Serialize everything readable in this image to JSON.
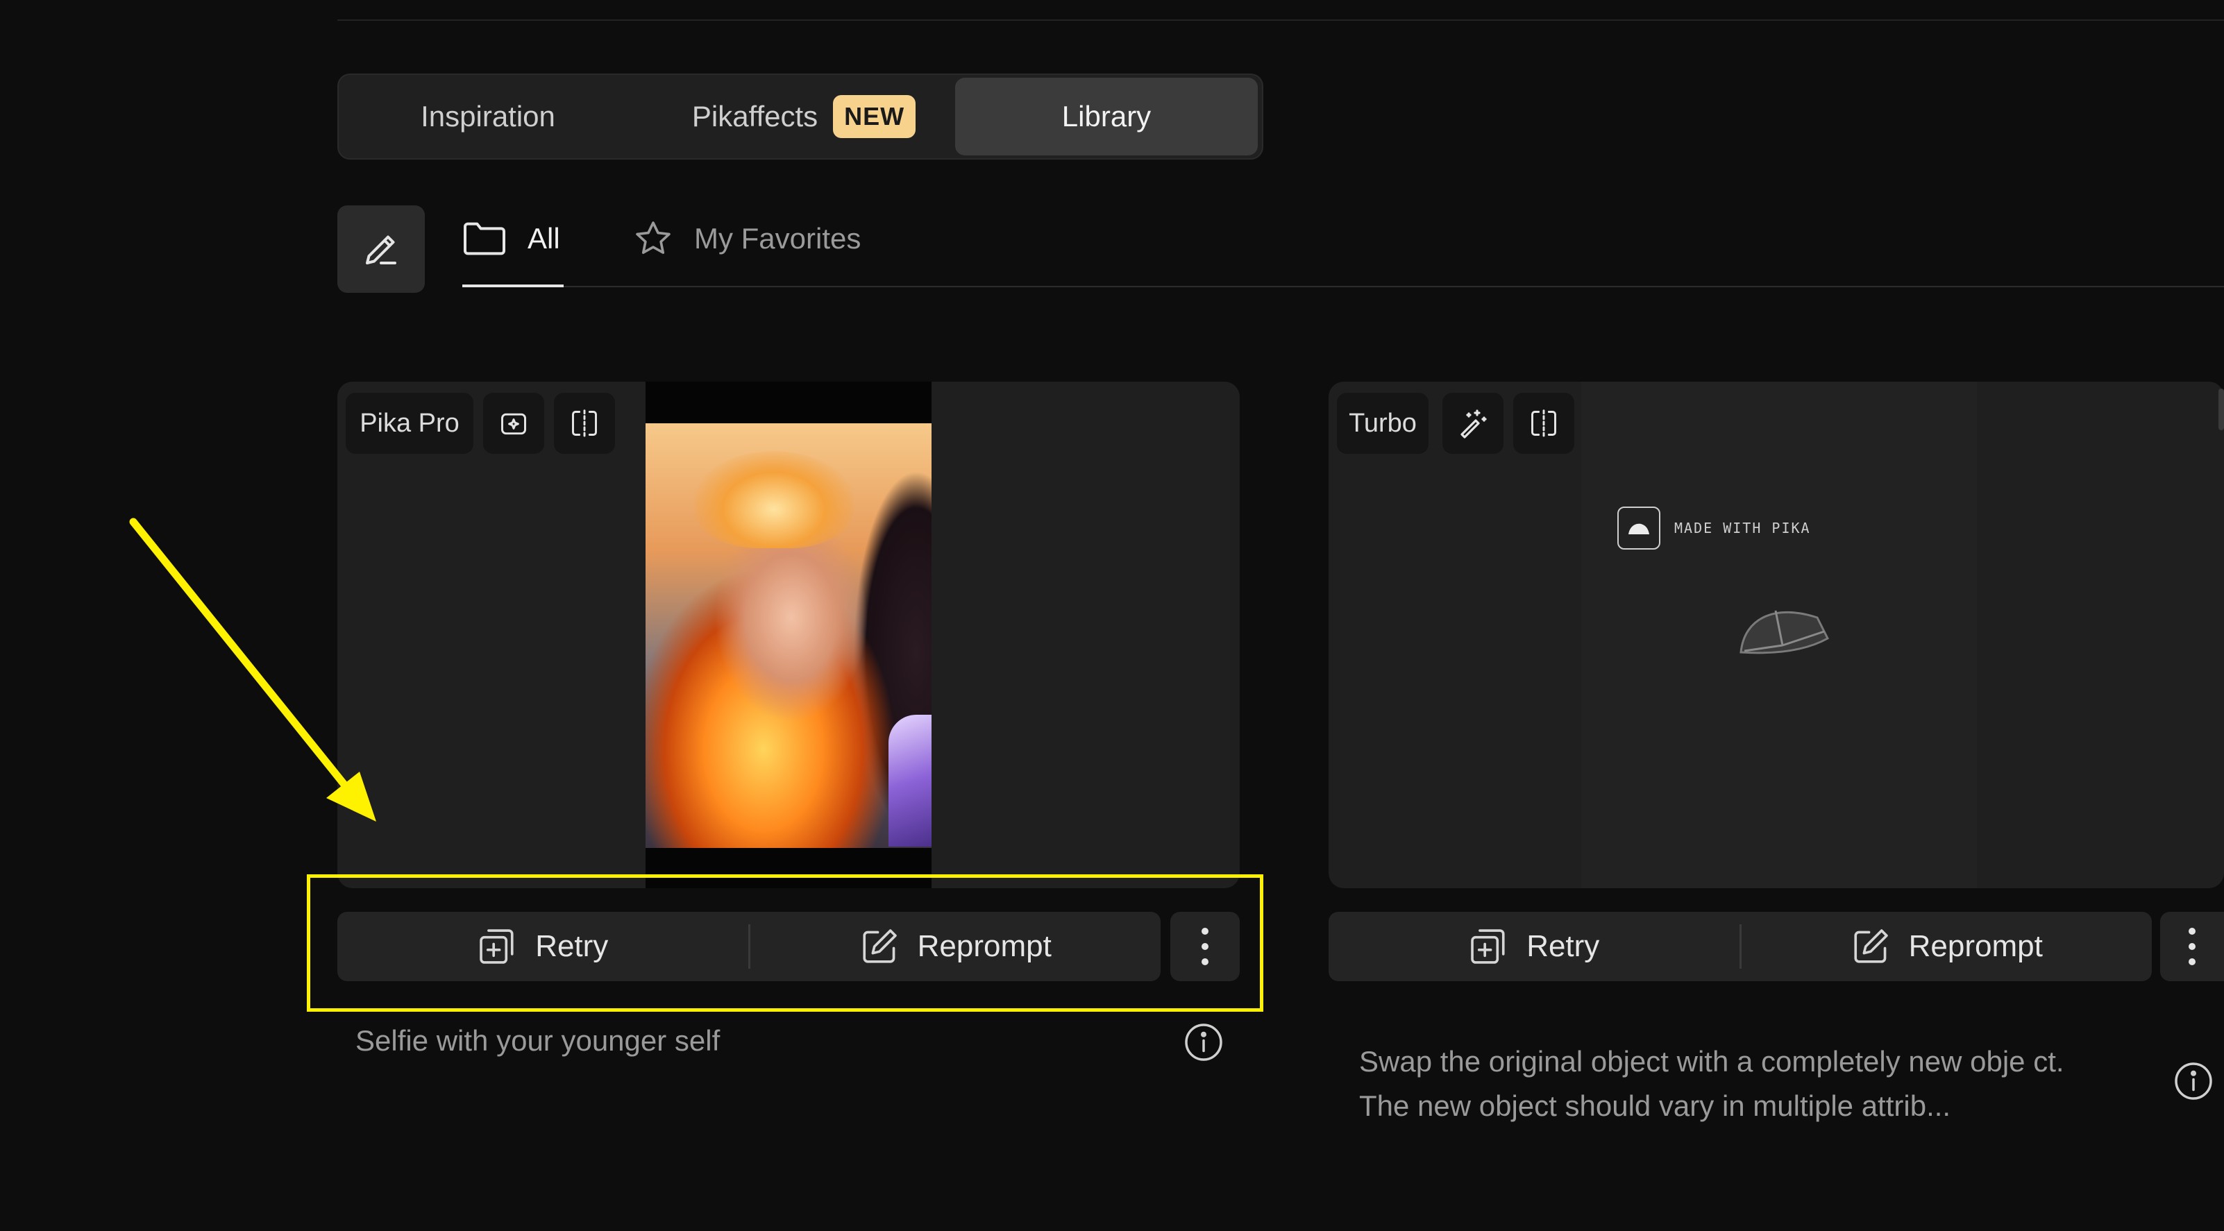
{
  "tabs": {
    "items": [
      {
        "label": "Inspiration"
      },
      {
        "label": "Pikaffects",
        "badge": "NEW"
      },
      {
        "label": "Library",
        "active": true
      }
    ]
  },
  "library_tabs": {
    "all": "All",
    "favorites": "My Favorites"
  },
  "cards": [
    {
      "model": "Pika Pro",
      "retry": "Retry",
      "reprompt": "Reprompt",
      "prompt": "Selfie with your younger self"
    },
    {
      "model": "Turbo",
      "watermark": "MADE WITH PIKA",
      "retry": "Retry",
      "reprompt": "Reprompt",
      "prompt": "Swap the original object with a completely new obje ct. The new object should vary in multiple attrib..."
    }
  ],
  "colors": {
    "background": "#0d0d0d",
    "badge": "#f6d28d",
    "highlight": "#fff200",
    "active_tab": "#3b3b3b"
  }
}
